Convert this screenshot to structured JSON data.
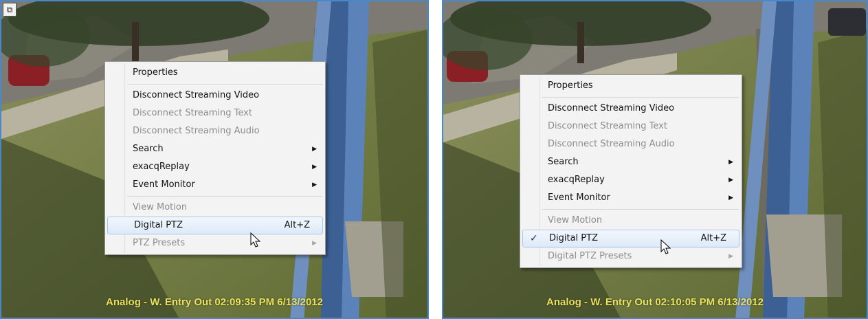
{
  "panels": [
    {
      "overlay": "Analog - W. Entry Out 02:09:35 PM 6/13/2012",
      "menu": {
        "properties": "Properties",
        "disconnect_video": "Disconnect Streaming Video",
        "disconnect_text": "Disconnect Streaming Text",
        "disconnect_audio": "Disconnect Streaming Audio",
        "search": "Search",
        "replay": "exacqReplay",
        "event_monitor": "Event Monitor",
        "view_motion": "View Motion",
        "digital_ptz": "Digital PTZ",
        "digital_ptz_shortcut": "Alt+Z",
        "presets": "PTZ Presets"
      }
    },
    {
      "overlay": "Analog - W. Entry Out 02:10:05 PM 6/13/2012",
      "menu": {
        "properties": "Properties",
        "disconnect_video": "Disconnect Streaming Video",
        "disconnect_text": "Disconnect Streaming Text",
        "disconnect_audio": "Disconnect Streaming Audio",
        "search": "Search",
        "replay": "exacqReplay",
        "event_monitor": "Event Monitor",
        "view_motion": "View Motion",
        "digital_ptz": "Digital PTZ",
        "digital_ptz_shortcut": "Alt+Z",
        "digital_ptz_checked": true,
        "presets": "Digital PTZ Presets"
      }
    }
  ],
  "icons": {
    "corner": "window-restore-icon",
    "submenu": "submenu-arrow-icon",
    "check": "checkmark-icon",
    "cursor": "mouse-pointer-icon"
  },
  "colors": {
    "frame_border": "#4a88c9",
    "overlay_text": "#e8e25a",
    "menu_bg": "#f3f3f3",
    "hover_bg": "#dde9f8"
  }
}
